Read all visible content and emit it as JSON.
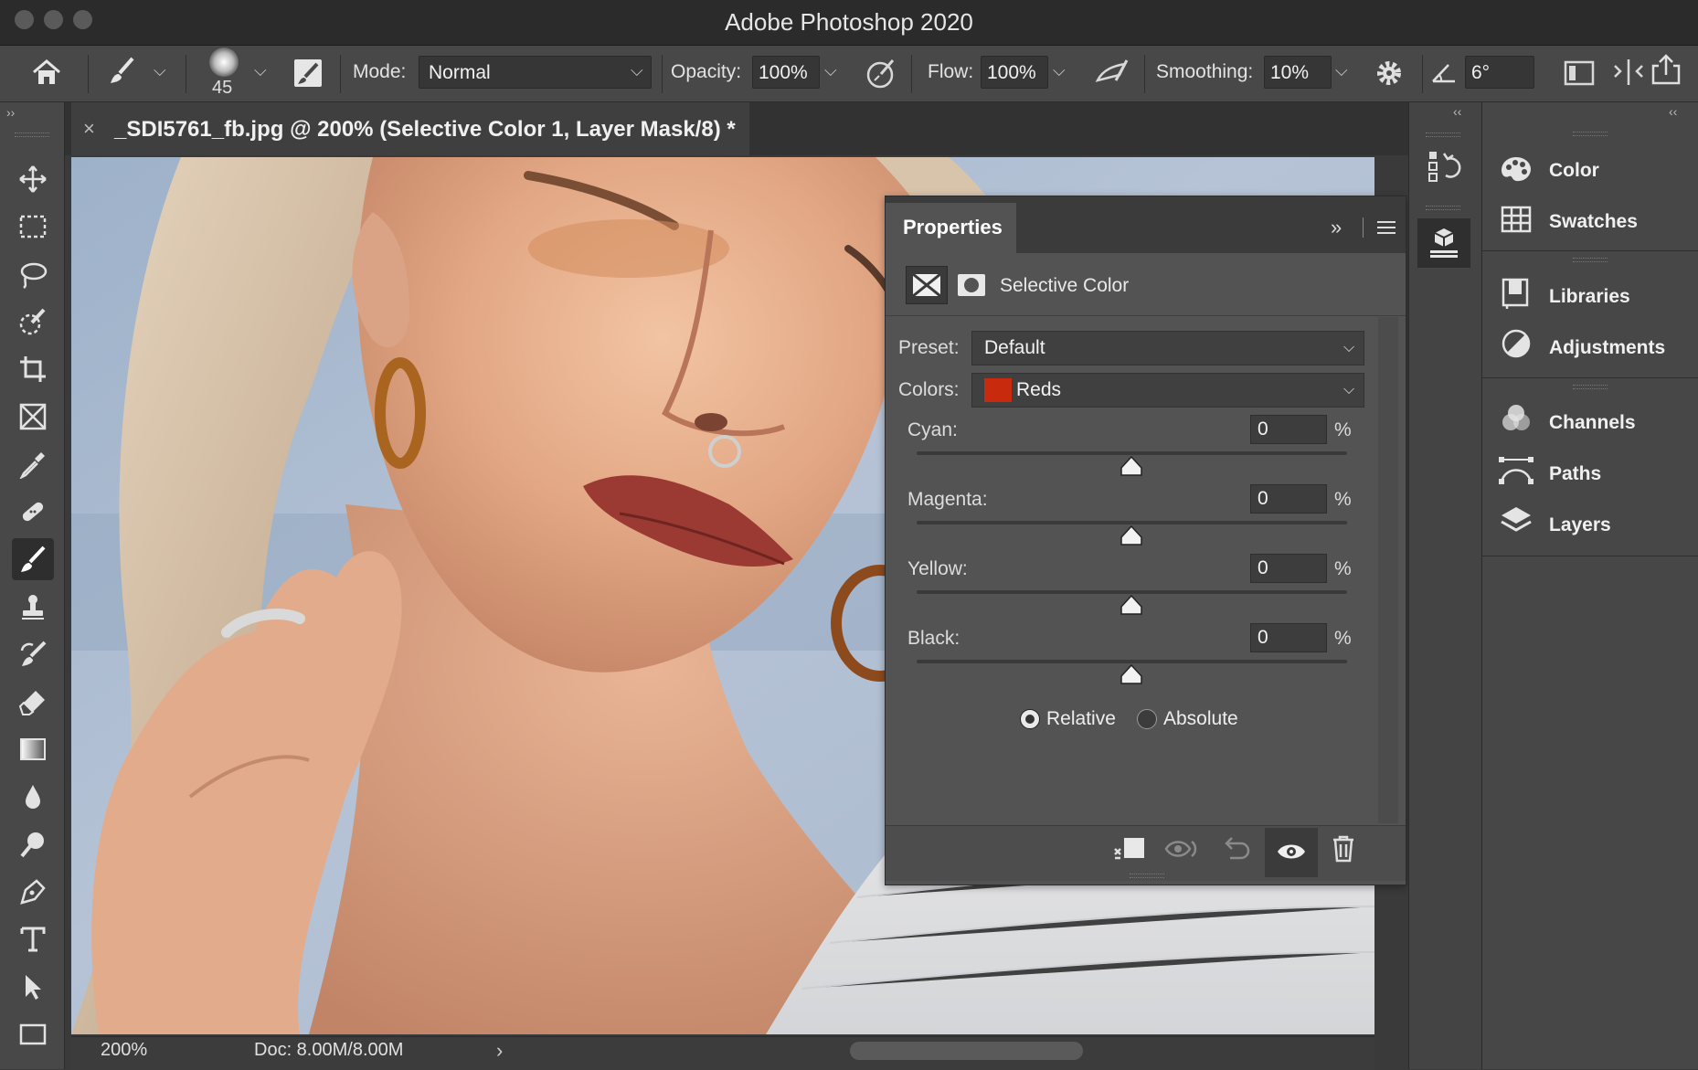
{
  "window": {
    "title": "Adobe Photoshop 2020"
  },
  "options_bar": {
    "brush_size": "45",
    "mode_label": "Mode:",
    "mode_value": "Normal",
    "opacity_label": "Opacity:",
    "opacity_value": "100%",
    "flow_label": "Flow:",
    "flow_value": "100%",
    "smoothing_label": "Smoothing:",
    "smoothing_value": "10%",
    "angle_value": "6°"
  },
  "document": {
    "tab_title": "_SDI5761_fb.jpg @ 200% (Selective Color 1, Layer Mask/8) *",
    "close_glyph": "×"
  },
  "status": {
    "zoom": "200%",
    "doc_size": "Doc: 8.00M/8.00M",
    "arrow": "›"
  },
  "properties": {
    "title": "Properties",
    "adjustment_name": "Selective Color",
    "preset_label": "Preset:",
    "preset_value": "Default",
    "colors_label": "Colors:",
    "colors_value": "Reds",
    "colors_swatch": "#c82a0e",
    "percent_sign": "%",
    "sliders": [
      {
        "label": "Cyan:",
        "value": "0"
      },
      {
        "label": "Magenta:",
        "value": "0"
      },
      {
        "label": "Yellow:",
        "value": "0"
      },
      {
        "label": "Black:",
        "value": "0"
      }
    ],
    "method_relative": "Relative",
    "method_absolute": "Absolute",
    "method_selected": "Relative"
  },
  "right_dock": {
    "items": [
      {
        "label": "Color",
        "icon": "color-palette-icon"
      },
      {
        "label": "Swatches",
        "icon": "swatches-grid-icon"
      },
      {
        "label": "Libraries",
        "icon": "libraries-icon"
      },
      {
        "label": "Adjustments",
        "icon": "adjustments-icon"
      },
      {
        "label": "Channels",
        "icon": "channels-icon"
      },
      {
        "label": "Paths",
        "icon": "paths-icon"
      },
      {
        "label": "Layers",
        "icon": "layers-icon"
      }
    ]
  },
  "colors": {
    "ui_dark": "#2b2b2b",
    "ui_mid": "#484848",
    "panel": "#535353",
    "reds_swatch": "#c82a0e"
  }
}
